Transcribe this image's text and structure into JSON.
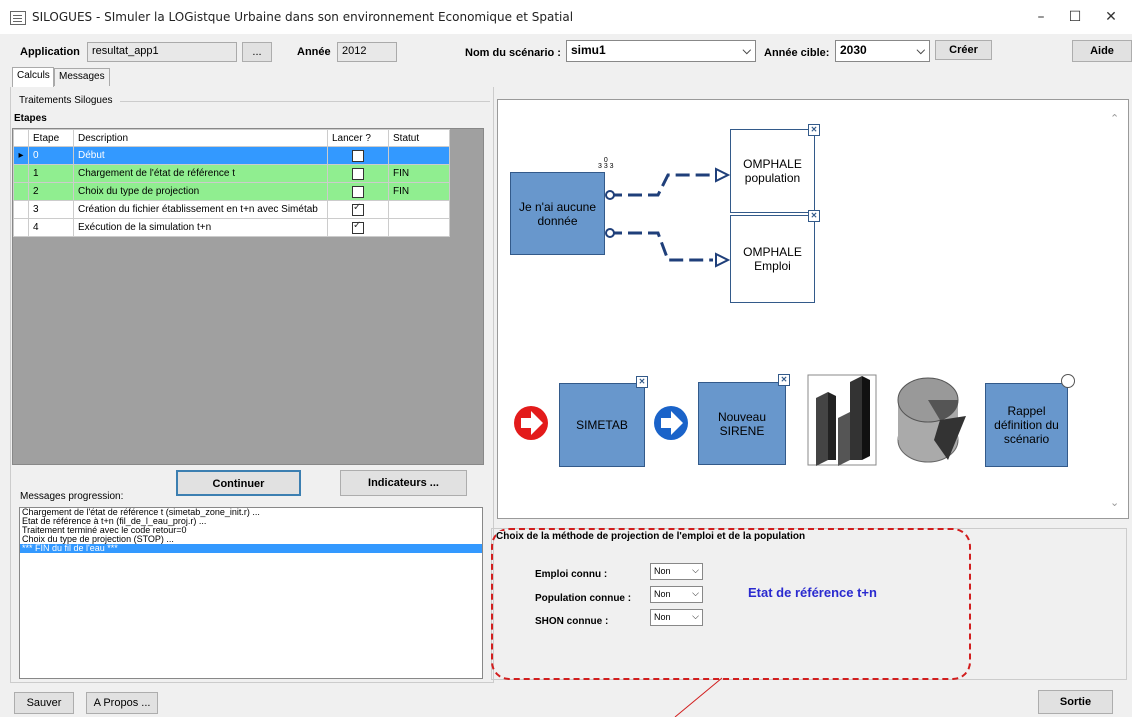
{
  "window": {
    "title": "SILOGUES - SImuler la LOGistque Urbaine dans son environnement Economique et Spatial"
  },
  "header": {
    "application_label": "Application",
    "application_value": "resultat_app1",
    "browse_label": "...",
    "annee_label": "Année",
    "annee_value": "2012",
    "scenario_label": "Nom du scénario :",
    "scenario_value": "simu1",
    "annee_cible_label": "Année cible:",
    "annee_cible_value": "2030",
    "creer_label": "Créer",
    "aide_label": "Aide"
  },
  "tabs": [
    "Calculs",
    "Messages"
  ],
  "group_title": "Traitements Silogues",
  "etapes_label": "Etapes",
  "grid": {
    "headers": [
      "Etape",
      "Description",
      "Lancer ?",
      "Statut"
    ],
    "rows": [
      {
        "etape": "0",
        "description": "Début",
        "lancer": false,
        "statut": ""
      },
      {
        "etape": "1",
        "description": "Chargement de l'état de référence t",
        "lancer": false,
        "statut": "FIN"
      },
      {
        "etape": "2",
        "description": "Choix du type de projection",
        "lancer": false,
        "statut": "FIN"
      },
      {
        "etape": "3",
        "description": "Création du fichier établissement en t+n avec Simétab",
        "lancer": true,
        "statut": ""
      },
      {
        "etape": "4",
        "description": "Exécution de la simulation t+n",
        "lancer": true,
        "statut": ""
      }
    ]
  },
  "buttons": {
    "continuer": "Continuer",
    "indicateurs": "Indicateurs ...",
    "sauver": "Sauver",
    "apropos": "A Propos ...",
    "sortie": "Sortie"
  },
  "messages_label": "Messages progression:",
  "messages": [
    "Chargement de l'état de référence t (simetab_zone_init.r) ...",
    "Etat de référence à t+n (fil_de_l_eau_proj.r) ...",
    "Traitement terminé avec le code retour=0",
    "Choix du type de projection (STOP) ...",
    "*** FIN du fil de l'eau ***"
  ],
  "diagram": {
    "source_box": "Je n'ai aucune donnée",
    "omphale_pop": "OMPHALE population",
    "omphale_emploi": "OMPHALE Emploi",
    "simetab": "SIMETAB",
    "nouveau_sirene": "Nouveau SIRENE",
    "rappel": "Rappel définition du scénario",
    "tiny_label": "0\n3 3 3"
  },
  "method": {
    "title": "Choix de la méthode de projection de l'emploi et de la population",
    "emploi_label": "Emploi connu :",
    "emploi_value": "Non",
    "population_label": "Population connue :",
    "population_value": "Non",
    "shon_label": "SHON connue :",
    "shon_value": "Non",
    "etat_text": "Etat de référence t+n"
  },
  "colors": {
    "selection": "#3399ff",
    "green_row": "#90ee90",
    "diagram_blue": "#6897cc",
    "dashed_red": "#d21e1e",
    "etat_blue": "#2a2acf"
  }
}
